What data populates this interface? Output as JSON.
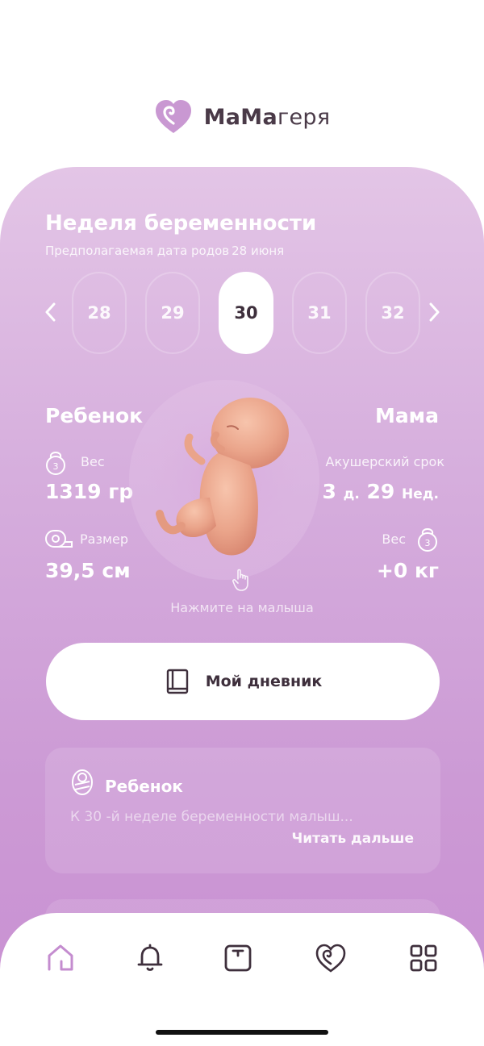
{
  "app": {
    "logo_bold": "МаМа",
    "logo_light": "геря"
  },
  "colors": {
    "accent": "#c98fd2",
    "accent_light": "#e3c5e6",
    "dark": "#3e2f3c"
  },
  "week_section": {
    "title": "Неделя беременности",
    "due_label": "Предполагаемая дата родов",
    "due_date": "28 июня",
    "weeks": [
      "28",
      "29",
      "30",
      "31",
      "32"
    ],
    "selected_week": "30"
  },
  "baby": {
    "title": "Ребенок",
    "weight_label": "Вес",
    "weight_value": "1319 гр",
    "size_label": "Размер",
    "size_value": "39,5 см"
  },
  "mom": {
    "title": "Мама",
    "term_label": "Акушерский срок",
    "term_days": "3",
    "term_days_unit": "д.",
    "term_weeks": "29",
    "term_weeks_unit": "Нед.",
    "weight_label": "Вес",
    "weight_value": "+0 кг"
  },
  "weight_icon_digit": "3",
  "tap_hint": "Нажмите на малыша",
  "diary_button": "Мой дневник",
  "info_card": {
    "title": "Ребенок",
    "text": "К 30 -й неделе беременности малыш...",
    "read_more": "Читать дальше"
  },
  "tabbar": {
    "icons": [
      "home-icon",
      "bell-icon",
      "scale-icon",
      "heart-icon",
      "grid-icon"
    ],
    "active": "home-icon"
  }
}
